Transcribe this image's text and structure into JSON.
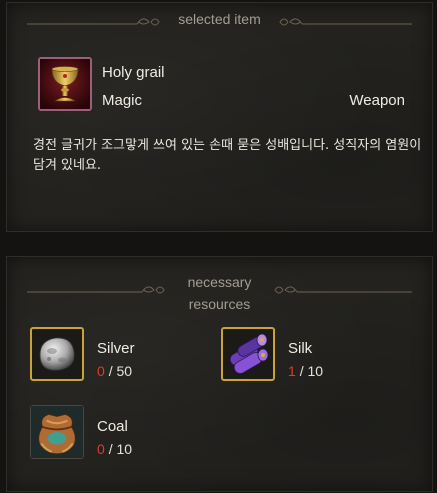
{
  "selected": {
    "header": "selected item",
    "item": {
      "name": "Holy grail",
      "grade": "Magic",
      "type": "Weapon",
      "icon": "holy-grail-icon",
      "description": "경전 글귀가 조그맣게 쓰여 있는 손때 묻은 성배입니다. 성직자의 염원이 담겨 있네요."
    }
  },
  "resources": {
    "header_line1": "necessary",
    "header_line2": "resources",
    "items": [
      {
        "name": "Silver",
        "have": "0",
        "need": "/ 50",
        "icon": "silver-ore-icon"
      },
      {
        "name": "Silk",
        "have": "1",
        "need": "/ 10",
        "icon": "silk-rolls-icon"
      },
      {
        "name": "Coal",
        "have": "0",
        "need": "/ 10",
        "icon": "coal-sack-icon"
      }
    ]
  },
  "colors": {
    "shortage": "#e03a2a",
    "slot_gold_border": "#c8a23a",
    "slot_magic_border": "#b06a8a"
  }
}
